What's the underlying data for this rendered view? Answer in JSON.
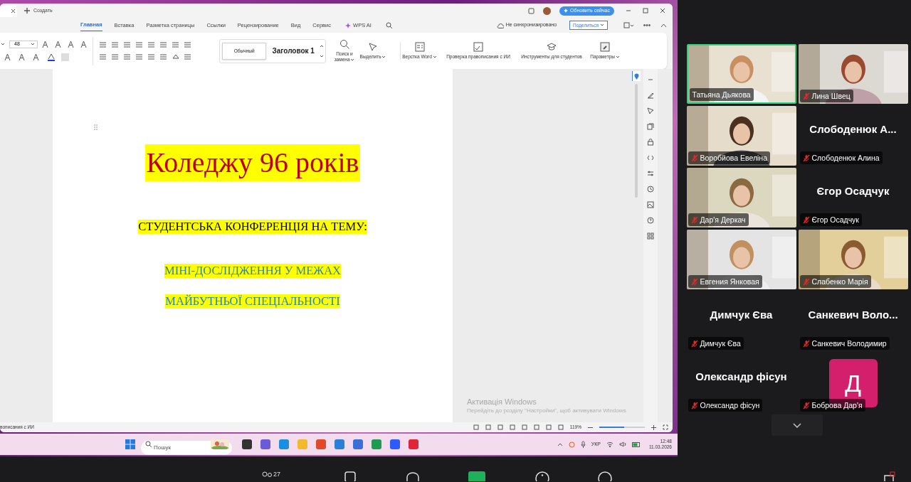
{
  "wps_window": {
    "new_tab_label": "Создать",
    "update_button": "Обновить сейчас",
    "ribbon_tabs": [
      {
        "label": "Главная",
        "selected": true
      },
      {
        "label": "Вставка",
        "selected": false
      },
      {
        "label": "Разметка страницы",
        "selected": false
      },
      {
        "label": "Ссылки",
        "selected": false
      },
      {
        "label": "Рецензирование",
        "selected": false
      },
      {
        "label": "Вид",
        "selected": false
      },
      {
        "label": "Сервис",
        "selected": false
      },
      {
        "label": "WPS AI",
        "selected": false
      }
    ],
    "sync_status": "Не синхронизировано",
    "share_button": "Поделиться",
    "font_size": "48",
    "styles": [
      {
        "label": "Обычный",
        "selected": true
      },
      {
        "label": "Заголовок 1",
        "selected": false
      }
    ],
    "tools": [
      {
        "label": "Поиск и замена",
        "dropdown": true
      },
      {
        "label": "Выделить",
        "dropdown": true
      },
      {
        "label": "Верстка Word",
        "dropdown": true
      },
      {
        "label": "Проверка правописания с ИИ",
        "dropdown": false
      },
      {
        "label": "Инструменты для студентов",
        "dropdown": false
      },
      {
        "label": "Параметры",
        "dropdown": true
      }
    ],
    "document": {
      "title": "Коледжу 96 років",
      "subtitle": "СТУДЕНТСЬКА КОНФЕРЕНЦІЯ НА ТЕМУ:",
      "topic_lines": [
        "МІНІ-ДОСЛІДЖЕННЯ У МЕЖАХ",
        "МАЙБУТНЬОЇ СПЕЦІАЛЬНОСТІ"
      ]
    },
    "status_bar": {
      "left_text": "вописания с ИИ",
      "zoom": "119%",
      "zoom_slider": {
        "level": 0.55
      }
    }
  },
  "windows_activation": {
    "title": "Активація Windows",
    "text": "Перейдіть до розділу \"Настройки\", щоб активувати Windows"
  },
  "taskbar": {
    "placeholder": "Пошук",
    "language": "УКР",
    "time": "12:48",
    "date": "11.03.2026"
  },
  "gallery_rows": [
    {
      "participants": [
        {
          "kind": "video",
          "name": "Татьяна Дьякова",
          "speaking": true,
          "muted": false
        },
        {
          "kind": "video",
          "name": "Лина Швец",
          "speaking": false,
          "muted": true
        }
      ]
    },
    {
      "participants": [
        {
          "kind": "video",
          "name": "Воробйова Евеліна",
          "speaking": false,
          "muted": true
        },
        {
          "kind": "name",
          "name": "Слободенюк Алина",
          "display": "Слободенюк  А...",
          "speaking": false,
          "muted": true
        }
      ]
    },
    {
      "participants": [
        {
          "kind": "video",
          "name": "Дар'я Деркач",
          "speaking": false,
          "muted": true
        },
        {
          "kind": "name",
          "name": "Єгор Осадчук",
          "display": "Єгор Осадчук",
          "speaking": false,
          "muted": true
        }
      ]
    },
    {
      "participants": [
        {
          "kind": "video",
          "name": "Евгения Янковая",
          "speaking": false,
          "muted": true
        },
        {
          "kind": "video",
          "name": "Слабенко Марія",
          "speaking": false,
          "muted": true
        }
      ]
    },
    {
      "participants": [
        {
          "kind": "name",
          "name": "Димчук Єва",
          "display": "Димчук Єва",
          "speaking": false,
          "muted": true
        },
        {
          "kind": "name",
          "name": "Санкевич Володимир",
          "display": "Санкевич  Воло...",
          "speaking": false,
          "muted": true
        }
      ]
    },
    {
      "participants": [
        {
          "kind": "name",
          "name": "Олександр фісун",
          "display": "Олександр фісун",
          "speaking": false,
          "muted": true
        },
        {
          "kind": "avatar",
          "initial": "Д",
          "name": "Боброва Дар'я",
          "speaking": false,
          "muted": true
        }
      ]
    }
  ],
  "meeting_toolbar": {
    "participants_count": "27"
  }
}
